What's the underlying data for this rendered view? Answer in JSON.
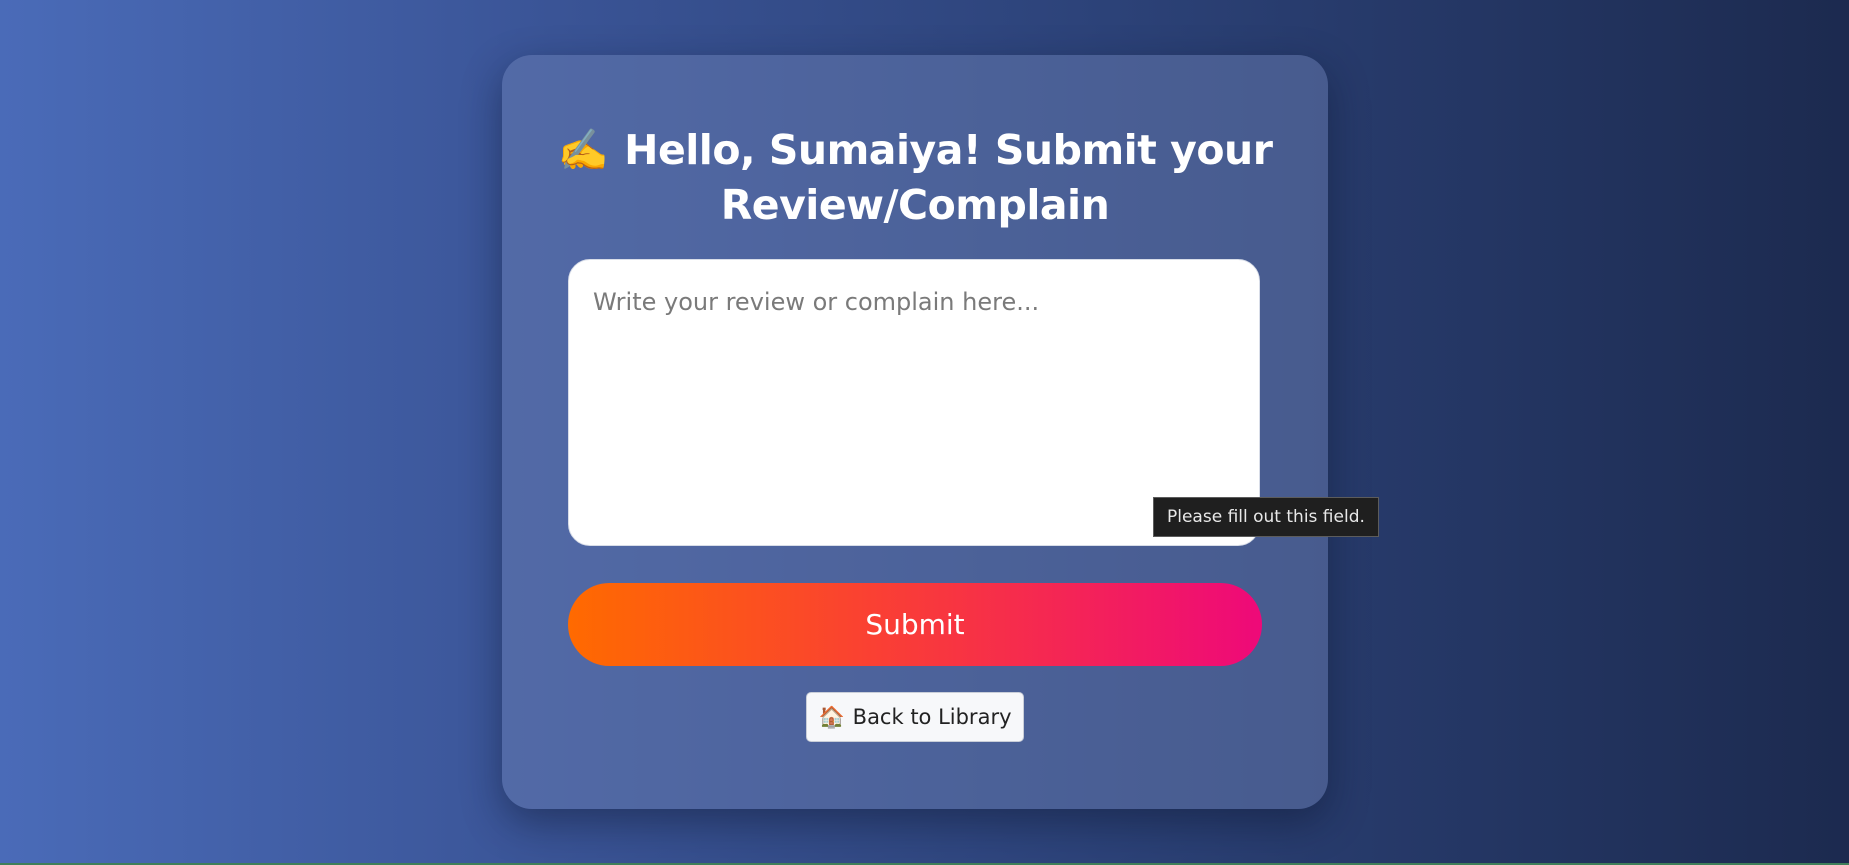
{
  "header": {
    "title_emoji": "✍️",
    "title_text": "Hello, Sumaiya! Submit your Review/Complain"
  },
  "review": {
    "placeholder": "Write your review or complain here...",
    "value": ""
  },
  "actions": {
    "submit_label": "Submit",
    "back_icon": "🏠",
    "back_label": "Back to Library"
  },
  "validation": {
    "tooltip": "Please fill out this field."
  },
  "colors": {
    "submit_gradient_start": "#ff6a00",
    "submit_gradient_end": "#ee0979",
    "background_start": "#4a6bb8",
    "background_end": "#1c2a4f"
  }
}
